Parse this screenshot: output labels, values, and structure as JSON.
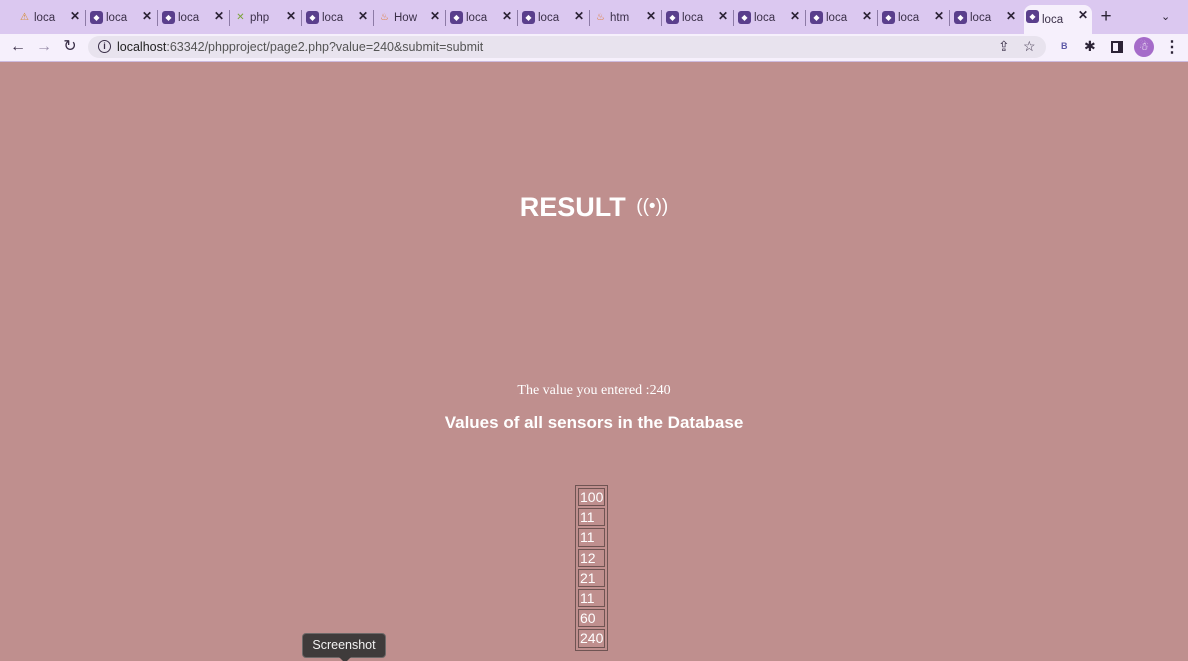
{
  "browser": {
    "tabs": [
      {
        "icon": "php-warning-icon",
        "glyph": "⚠",
        "label": "loca",
        "active": false
      },
      {
        "icon": "localhost-icon",
        "glyph": "◆",
        "label": "loca",
        "active": false
      },
      {
        "icon": "localhost-icon",
        "glyph": "◆",
        "label": "loca",
        "active": false
      },
      {
        "icon": "jetbrains-icon",
        "glyph": "✕",
        "label": "php",
        "active": false
      },
      {
        "icon": "localhost-icon",
        "glyph": "◆",
        "label": "loca",
        "active": false
      },
      {
        "icon": "java-icon",
        "glyph": "♨",
        "label": "How",
        "active": false
      },
      {
        "icon": "localhost-icon",
        "glyph": "◆",
        "label": "loca",
        "active": false
      },
      {
        "icon": "localhost-icon",
        "glyph": "◆",
        "label": "loca",
        "active": false
      },
      {
        "icon": "java-icon",
        "glyph": "♨",
        "label": "htm",
        "active": false
      },
      {
        "icon": "localhost-icon",
        "glyph": "◆",
        "label": "loca",
        "active": false
      },
      {
        "icon": "localhost-icon",
        "glyph": "◆",
        "label": "loca",
        "active": false
      },
      {
        "icon": "localhost-icon",
        "glyph": "◆",
        "label": "loca",
        "active": false
      },
      {
        "icon": "localhost-icon",
        "glyph": "◆",
        "label": "loca",
        "active": false
      },
      {
        "icon": "localhost-icon",
        "glyph": "◆",
        "label": "loca",
        "active": false
      },
      {
        "icon": "localhost-icon",
        "glyph": "◆",
        "label": "loca",
        "active": true
      }
    ],
    "close_glyph": "✕",
    "new_tab_glyph": "+",
    "tab_search_glyph": "⌄",
    "nav": {
      "back": "←",
      "forward": "→",
      "reload": "↻"
    },
    "url_host": "localhost",
    "url_rest": ":63342/phpproject/page2.php?value=240&submit=submit",
    "toolbar_icons": {
      "share": "⇪",
      "bookmark": "☆",
      "extension_b": "B",
      "puzzle": "✱",
      "profile": "☃",
      "menu": "⋮"
    },
    "accent": "#dbc8f0"
  },
  "page": {
    "background": "#bf8f8e",
    "title": "RESULT",
    "title_icon": "((•))",
    "entered_text": "The value you entered :240",
    "heading": "Values of all sensors in the Database",
    "sensor_values": [
      "100",
      "11",
      "11",
      "12",
      "21",
      "11",
      "60",
      "240"
    ]
  },
  "tooltip": {
    "text": "Screenshot"
  }
}
